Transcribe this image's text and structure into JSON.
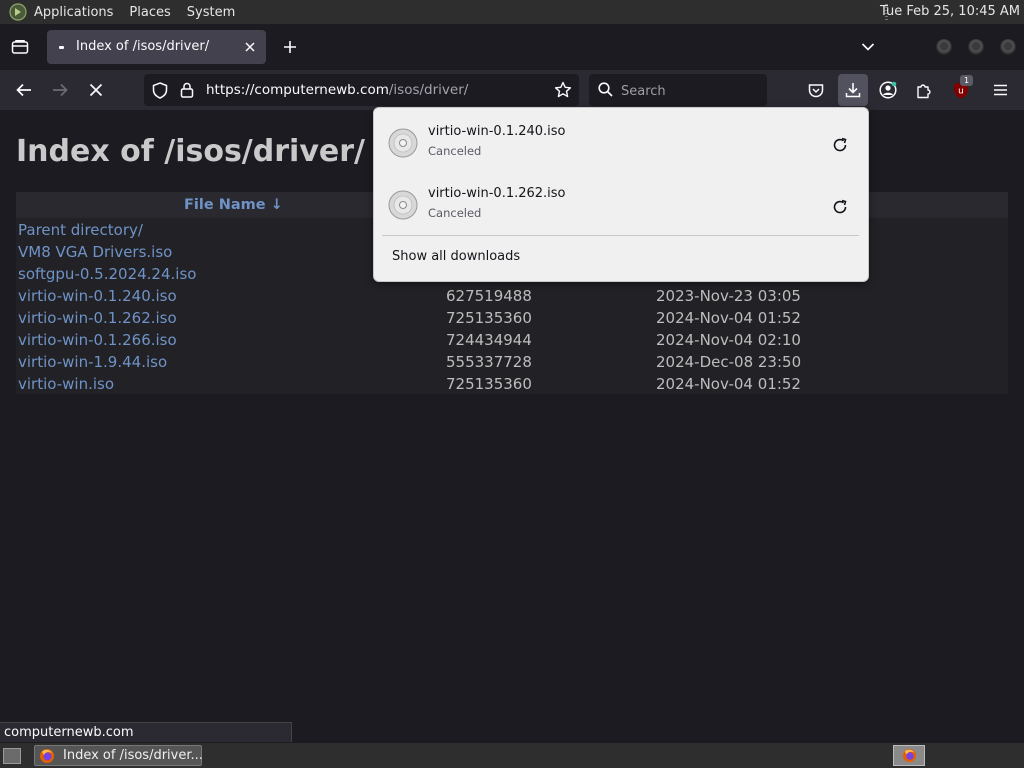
{
  "system_panel": {
    "menus": [
      "Applications",
      "Places",
      "System"
    ],
    "clock": "Tue Feb 25, 10:45 AM"
  },
  "browser": {
    "tab": {
      "title": "Index of /isos/driver/"
    },
    "url": {
      "host": "https://computernewb.com",
      "path": "/isos/driver/"
    },
    "search": {
      "placeholder": "Search"
    },
    "extension_badge": "1",
    "status_url": "computernewb.com"
  },
  "page": {
    "title": "Index of /isos/driver/",
    "column_name": "File Name ↓",
    "rows": [
      {
        "name": "Parent directory/",
        "size": "",
        "date": ""
      },
      {
        "name": "VM8 VGA Drivers.iso",
        "size": "",
        "date": ""
      },
      {
        "name": "softgpu-0.5.2024.24.iso",
        "size": "",
        "date": ""
      },
      {
        "name": "virtio-win-0.1.240.iso",
        "size": "627519488",
        "date": "2023-Nov-23 03:05"
      },
      {
        "name": "virtio-win-0.1.262.iso",
        "size": "725135360",
        "date": "2024-Nov-04 01:52"
      },
      {
        "name": "virtio-win-0.1.266.iso",
        "size": "724434944",
        "date": "2024-Nov-04 02:10"
      },
      {
        "name": "virtio-win-1.9.44.iso",
        "size": "555337728",
        "date": "2024-Dec-08 23:50"
      },
      {
        "name": "virtio-win.iso",
        "size": "725135360",
        "date": "2024-Nov-04 01:52"
      }
    ]
  },
  "downloads_panel": {
    "items": [
      {
        "filename": "virtio-win-0.1.240.iso",
        "status": "Canceled"
      },
      {
        "filename": "virtio-win-0.1.262.iso",
        "status": "Canceled"
      }
    ],
    "show_all": "Show all downloads"
  },
  "taskbar": {
    "task_label": "Index of /isos/driver..."
  },
  "colors": {
    "link": "#6f93c6",
    "page_bg": "#1c1b22",
    "toolbar_bg": "#2b2a33",
    "panel_bg": "#f0f0f0"
  },
  "icons": [
    "mate-logo-icon",
    "tab-list-icon",
    "close-icon",
    "plus-icon",
    "chevron-down-icon",
    "back-arrow-icon",
    "forward-arrow-icon",
    "stop-icon",
    "shield-icon",
    "lock-icon",
    "star-icon",
    "search-icon",
    "pocket-icon",
    "download-icon",
    "account-icon",
    "extensions-icon",
    "ublock-icon",
    "hamburger-menu-icon",
    "disc-icon",
    "retry-icon",
    "firefox-icon"
  ]
}
